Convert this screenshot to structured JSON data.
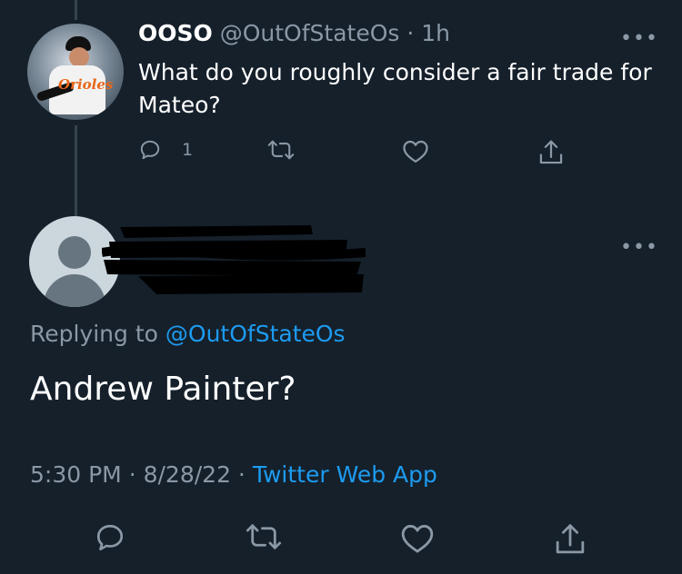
{
  "tweet1": {
    "display_name": "OOSO",
    "handle": "@OutOfStateOs",
    "separator": "·",
    "time_ago": "1h",
    "text": "What do you roughly consider a fair trade for Mateo?",
    "avatar_script": "Orioles",
    "more_icon": "more-horizontal-icon",
    "actions": {
      "reply_count": "1",
      "reply_icon": "reply-icon",
      "retweet_icon": "retweet-icon",
      "like_icon": "heart-icon",
      "share_icon": "share-icon"
    }
  },
  "tweet2": {
    "replying_prefix": "Replying to",
    "replying_handle": "@OutOfStateOs",
    "text": "Andrew Painter?",
    "time": "5:30 PM",
    "sep1": "·",
    "date": "8/28/22",
    "sep2": "·",
    "app": "Twitter Web App",
    "avatar_icon": "default-avatar-icon",
    "more_icon": "more-horizontal-icon"
  },
  "colors": {
    "background": "#15202b",
    "text_primary": "#ffffff",
    "text_secondary": "#8b98a5",
    "accent": "#1d9bf0",
    "thread_line": "#38444d"
  }
}
